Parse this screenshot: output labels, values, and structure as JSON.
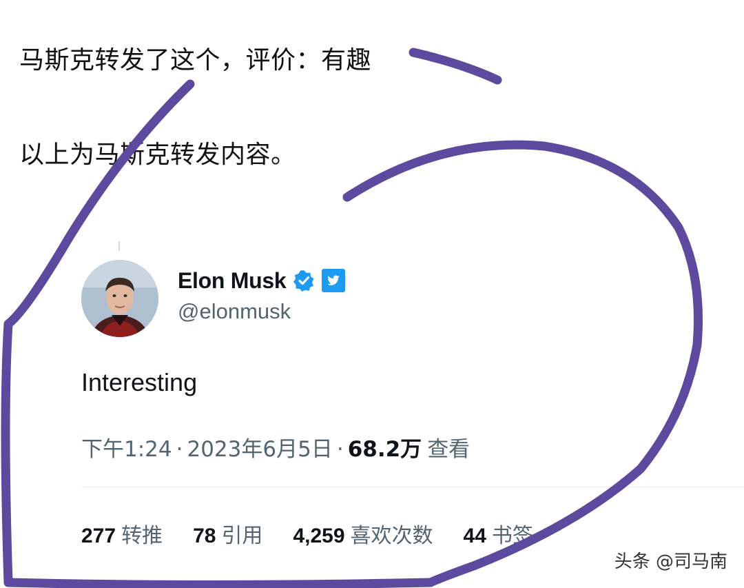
{
  "caption": {
    "line1": "马斯克转发了这个，评价：有趣",
    "line2": "以上为马斯克转发内容。"
  },
  "tweet": {
    "author": {
      "display_name": "Elon Musk",
      "handle": "@elonmusk",
      "verified_icon": "verified-badge-icon",
      "affiliation_icon": "twitter-bird-icon"
    },
    "text": "Interesting",
    "meta": {
      "time": "下午1:24",
      "separator": "·",
      "date": "2023年6月5日",
      "views_count": "68.2万",
      "views_label": "查看"
    },
    "stats": [
      {
        "count": "277",
        "label": "转推"
      },
      {
        "count": "78",
        "label": "引用"
      },
      {
        "count": "4,259",
        "label": "喜欢次数"
      },
      {
        "count": "44",
        "label": "书签"
      }
    ]
  },
  "watermark": "头条 @司马南",
  "colors": {
    "annotation_stroke": "#5b4a9e",
    "verified_blue": "#1d9bf0",
    "text_primary": "#0f1419",
    "text_secondary": "#536471"
  }
}
